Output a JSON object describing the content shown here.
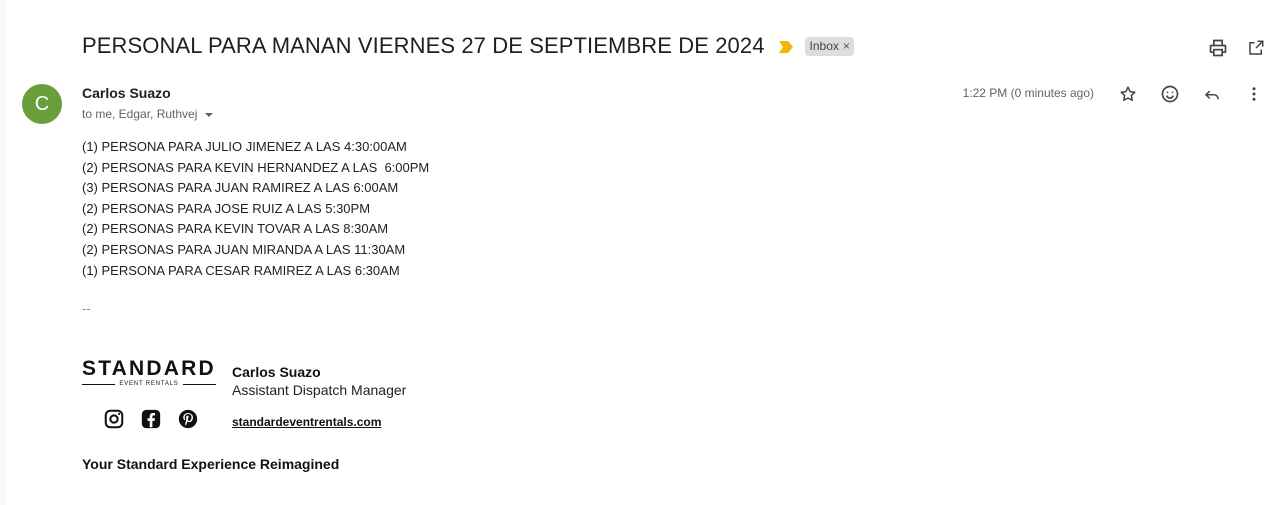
{
  "email": {
    "subject": "PERSONAL PARA MANAN VIERNES 27 DE SEPTIEMBRE DE 2024",
    "label": "Inbox",
    "label_remove": "×",
    "sender": {
      "avatar_letter": "C",
      "avatar_color": "#689f38",
      "name": "Carlos Suazo",
      "recipients": "to me, Edgar, Ruthvej"
    },
    "time": "1:22 PM (0 minutes ago)",
    "body": [
      "(1) PERSONA PARA JULIO JIMENEZ A LAS 4:30:00AM",
      "(2) PERSONAS PARA KEVIN HERNANDEZ A LAS  6:00PM",
      "(3) PERSONAS PARA JUAN RAMIREZ A LAS 6:00AM",
      "(2) PERSONAS PARA JOSE RUIZ A LAS 5:30PM",
      "(2) PERSONAS PARA KEVIN TOVAR A LAS 8:30AM",
      "(2) PERSONAS PARA JUAN MIRANDA A LAS 11:30AM",
      "(1) PERSONA PARA CESAR RAMIREZ A LAS 6:30AM"
    ],
    "signature": {
      "separator": "--",
      "logo_main": "STANDARD",
      "logo_sub": "EVENT RENTALS",
      "name": "Carlos Suazo",
      "title": "Assistant Dispatch Manager",
      "website": "standardeventrentals.com",
      "tagline": "Your Standard Experience Reimagined"
    }
  },
  "icons": {
    "importance": "importance-marker-icon",
    "print": "print-icon",
    "open_new": "open-in-new-window-icon",
    "star": "star-icon",
    "emoji": "emoji-icon",
    "reply": "reply-icon",
    "more": "more-vert-icon",
    "instagram": "instagram-icon",
    "facebook": "facebook-icon",
    "pinterest": "pinterest-icon"
  },
  "colors": {
    "importance": "#f4b400",
    "label_bg": "#dddddd"
  }
}
